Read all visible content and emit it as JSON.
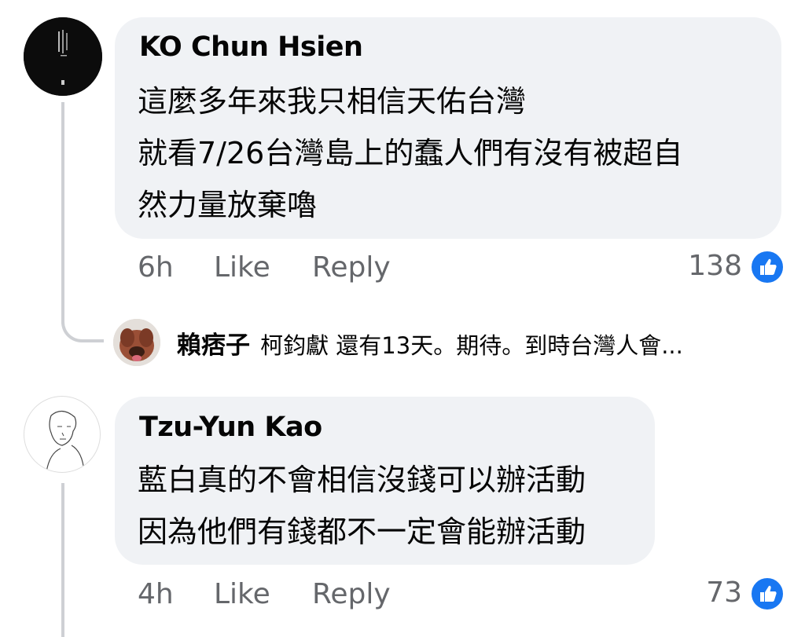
{
  "comments": [
    {
      "author": "KO Chun Hsien",
      "lines": [
        "這麼多年來我只相信天佑台灣",
        "就看7/26台灣島上的蠢人們有沒有被超自",
        "然力量放棄嚕"
      ],
      "time": "6h",
      "like_label": "Like",
      "reply_label": "Reply",
      "reaction_count": "138",
      "reply_preview": {
        "author": "賴痞子",
        "text": "柯鈞獻 還有13天。期待。到時台灣人會..."
      }
    },
    {
      "author": "Tzu-Yun Kao",
      "lines": [
        "藍白真的不會相信沒錢可以辦活動",
        "因為他們有錢都不一定會能辦活動"
      ],
      "time": "4h",
      "like_label": "Like",
      "reply_label": "Reply",
      "reaction_count": "73"
    }
  ],
  "colors": {
    "bubble": "#f0f2f5",
    "meta_text": "#65676b",
    "like_blue": "#1877f2",
    "thread_line": "#ced0d4"
  },
  "icons": {
    "avatar_1": "book-cover-avatar",
    "avatar_reply": "dog-face-avatar",
    "avatar_2": "sketch-portrait-avatar",
    "reaction": "thumbs-up-icon"
  }
}
